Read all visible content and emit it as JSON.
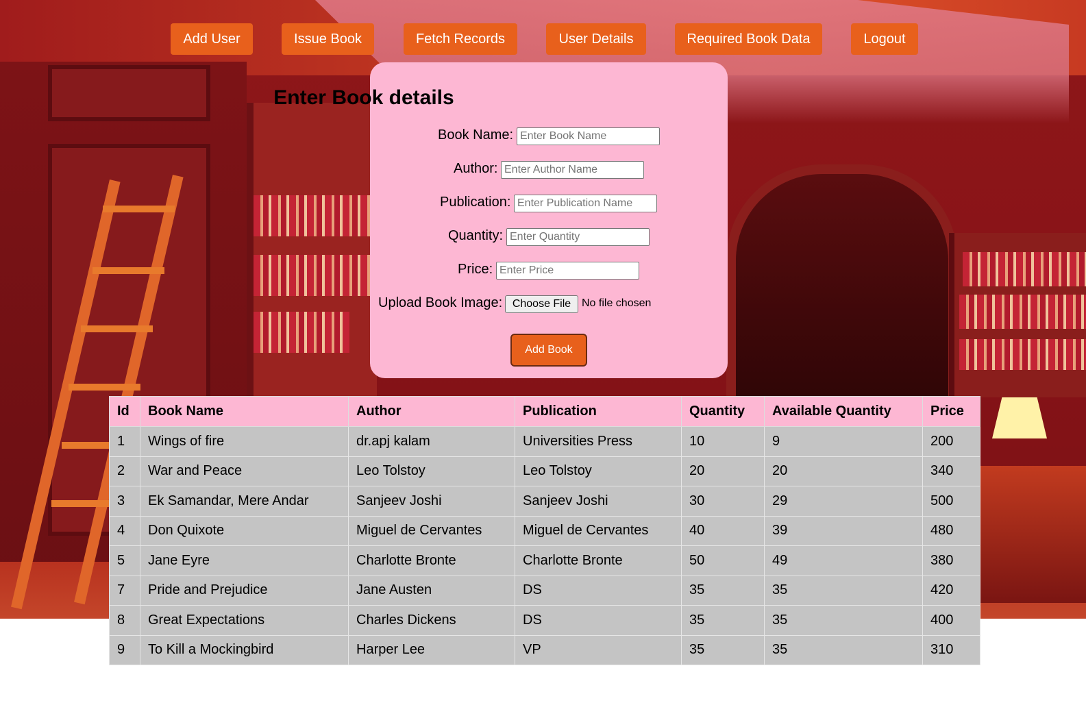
{
  "nav": {
    "add_user": "Add User",
    "issue_book": "Issue Book",
    "fetch_records": "Fetch Records",
    "user_details": "User Details",
    "required_book_data": "Required Book Data",
    "logout": "Logout"
  },
  "form": {
    "title": "Enter Book details",
    "book_name_label": "Book Name:",
    "book_name_placeholder": "Enter Book Name",
    "author_label": "Author:",
    "author_placeholder": "Enter Author Name",
    "publication_label": "Publication:",
    "publication_placeholder": "Enter Publication Name",
    "quantity_label": "Quantity:",
    "quantity_placeholder": "Enter Quantity",
    "price_label": "Price:",
    "price_placeholder": "Enter Price",
    "upload_label": "Upload Book Image:",
    "choose_file": "Choose File",
    "file_status": "No file chosen",
    "submit": "Add Book"
  },
  "table": {
    "headers": [
      "Id",
      "Book Name",
      "Author",
      "Publication",
      "Quantity",
      "Available Quantity",
      "Price"
    ],
    "rows": [
      [
        "1",
        "Wings of fire",
        "dr.apj kalam",
        "Universities Press",
        "10",
        "9",
        "200"
      ],
      [
        "2",
        "War and Peace",
        "Leo Tolstoy",
        "Leo Tolstoy",
        "20",
        "20",
        "340"
      ],
      [
        "3",
        "Ek Samandar, Mere Andar",
        "Sanjeev Joshi",
        "Sanjeev Joshi",
        "30",
        "29",
        "500"
      ],
      [
        "4",
        "Don Quixote",
        "Miguel de Cervantes",
        "Miguel de Cervantes",
        "40",
        "39",
        "480"
      ],
      [
        "5",
        "Jane Eyre",
        "Charlotte Bronte",
        "Charlotte Bronte",
        "50",
        "49",
        "380"
      ],
      [
        "7",
        "Pride and Prejudice",
        "Jane Austen",
        "DS",
        "35",
        "35",
        "420"
      ],
      [
        "8",
        "Great Expectations",
        "Charles Dickens",
        "DS",
        "35",
        "35",
        "400"
      ],
      [
        "9",
        "To Kill a Mockingbird",
        "Harper Lee",
        "VP",
        "35",
        "35",
        "310"
      ]
    ]
  },
  "colors": {
    "accent": "#e8601c",
    "card": "#fdb7d3",
    "row": "#c4c4c4"
  }
}
